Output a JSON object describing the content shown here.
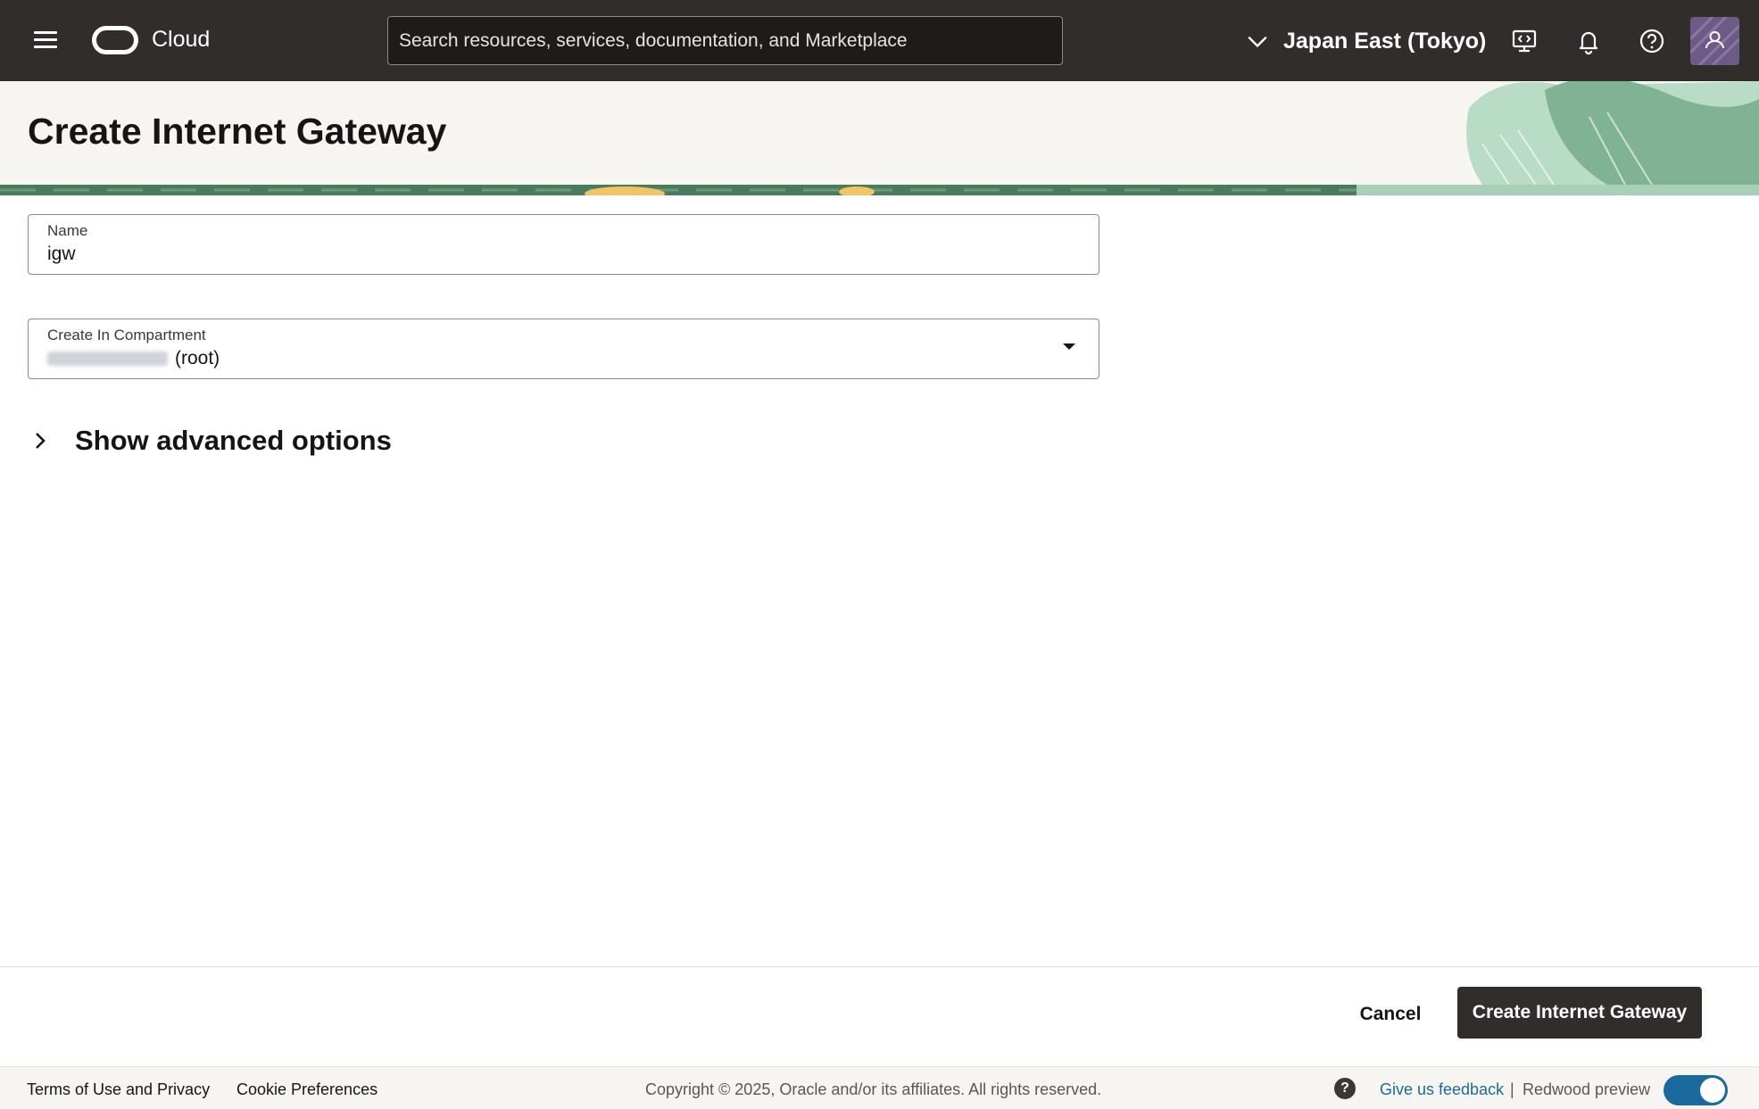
{
  "topbar": {
    "brand": "Cloud",
    "search_placeholder": "Search resources, services, documentation, and Marketplace",
    "region": "Japan East (Tokyo)",
    "icons": [
      "menu-icon",
      "oracle-logo-icon",
      "chevron-down-icon",
      "developer-tools-icon",
      "bell-icon",
      "help-icon",
      "user-avatar-icon"
    ]
  },
  "page": {
    "title": "Create Internet Gateway"
  },
  "form": {
    "name": {
      "label": "Name",
      "value": "igw"
    },
    "compartment": {
      "label": "Create In Compartment",
      "value_suffix": "(root)"
    },
    "advanced": {
      "label": "Show advanced options"
    }
  },
  "actions": {
    "cancel": "Cancel",
    "create": "Create Internet Gateway"
  },
  "footer": {
    "terms": "Terms of Use and Privacy",
    "cookies": "Cookie Preferences",
    "copyright": "Copyright © 2025, Oracle and/or its affiliates. All rights reserved.",
    "help_glyph": "?",
    "feedback": "Give us feedback",
    "separator": "|",
    "redwood": "Redwood preview",
    "redwood_enabled": true
  },
  "colors": {
    "topbar_bg": "#312d2a",
    "primary_button": "#312d2a",
    "link": "#1a6a9e",
    "banner_green": "#4a7b5c"
  }
}
